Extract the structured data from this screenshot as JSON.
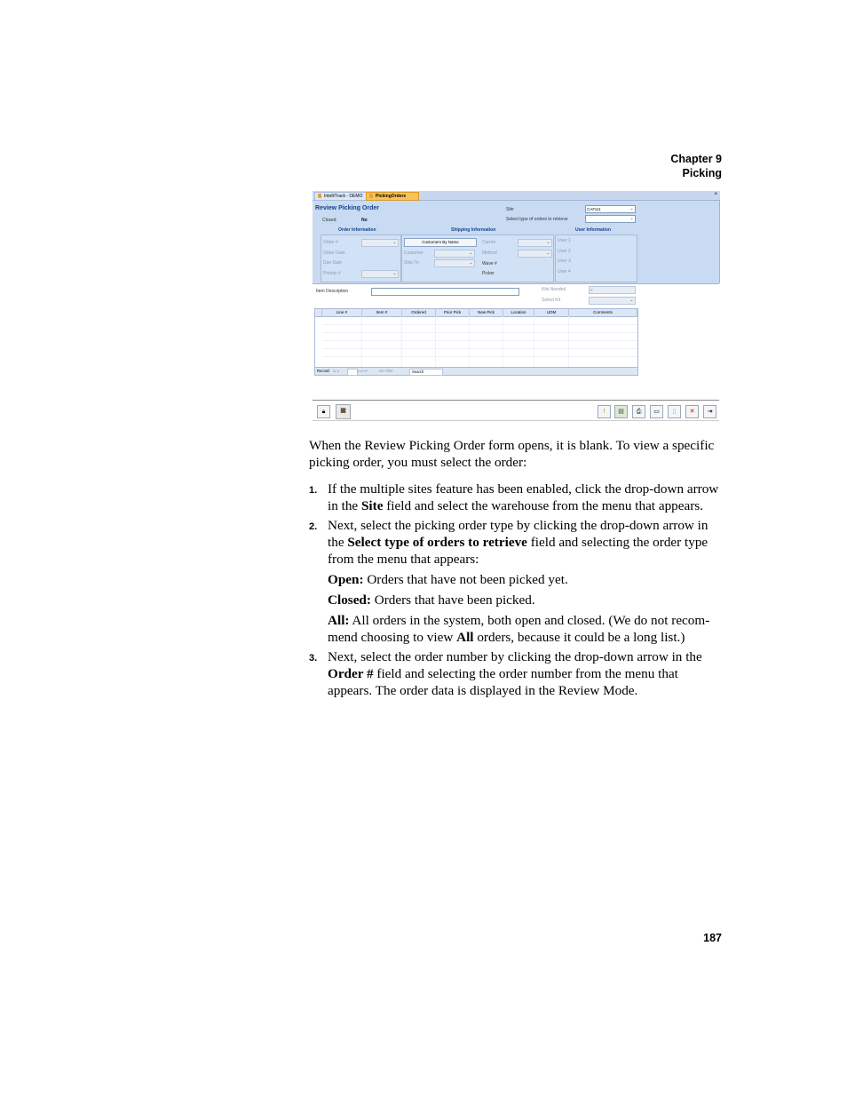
{
  "header": {
    "chapter": "Chapter 9",
    "section": "Picking"
  },
  "page_number": "187",
  "screenshot": {
    "tabs": [
      "IntelliTrack - DEMO",
      "PickingOrders"
    ],
    "close_glyph": "×",
    "form_title": "Review Picking Order",
    "closed_label": "Closed",
    "closed_value": "No",
    "site_label": "Site",
    "site_value": "CA#111",
    "type_label": "Select type of orders to retrieve",
    "groups": [
      "Order Information",
      "Shipping Information",
      "User Information"
    ],
    "order_fields": [
      "Order #",
      "Order Date",
      "Due Date",
      "Priority #"
    ],
    "customers_by_name": "Customers By Name",
    "shipping_fields": [
      "Customer",
      "Ship To"
    ],
    "carrier_fields": [
      "Carrier",
      "Method"
    ],
    "wave_label": "Wave #",
    "picker_label": "Picker",
    "user_fields": [
      "User 1",
      "User 2",
      "User 3",
      "User 4"
    ],
    "item_description_label": "Item Description",
    "kits_needed_label": "Kits Needed",
    "kits_needed_value": "0",
    "select_kit_label": "Select Kit",
    "columns": [
      "Line #",
      "Item #",
      "Ordered",
      "Prior Pick",
      "New Pick",
      "Location",
      "UOM",
      "Comments"
    ],
    "nav": {
      "record": "Record:",
      "nav_glyphs": "I◂  ◂",
      "nav_glyphs2": "▸  ▸I  ▸*",
      "filter": "No Filter",
      "search": "Search"
    },
    "toolbar_icons": [
      "lock-icon",
      "report-icon",
      "alert-icon",
      "review-icon",
      "preview-icon",
      "print-icon",
      "delete-icon",
      "close-icon",
      "exit-icon"
    ]
  },
  "body": {
    "intro": "When the Review Picking Order form opens, it is blank. To view a specific picking order, you must select the order:",
    "step1_num": "1.",
    "step1_a": "If the multiple sites feature has been enabled, click the drop-down arrow in the ",
    "step1_bold": "Site",
    "step1_b": " field and select the warehouse from the menu that appears.",
    "step2_num": "2.",
    "step2_a": "Next, select the picking order type by clicking the drop-down arrow in the ",
    "step2_bold": "Select type of orders to retrieve",
    "step2_b": " field and selecting the order type from the menu that appears:",
    "open_label": "Open:",
    "open_text": " Orders that have not been picked yet.",
    "closed_label": "Closed:",
    "closed_text": " Orders that have been picked.",
    "all_label": "All:",
    "all_text_a": " All orders in the system, both open and closed. (We do not recom-mend choosing to view ",
    "all_bold": "All",
    "all_text_b": " orders, because it could be a long list.)",
    "step3_num": "3.",
    "step3_a": "Next, select the order number by clicking the drop-down arrow in the ",
    "step3_bold": "Order #",
    "step3_b": " field and selecting the order number from the menu that appears. The order data is displayed in the Review Mode."
  }
}
